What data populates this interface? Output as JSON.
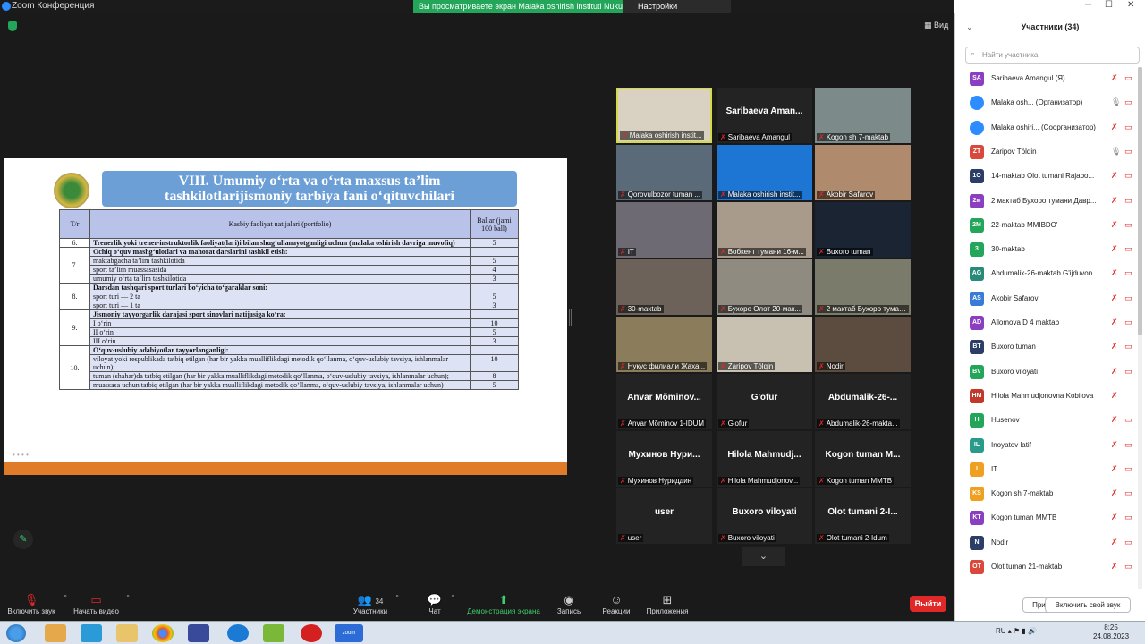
{
  "window": {
    "title": "Zoom Конференция",
    "banner": "Вы просматриваете экран Malaka oshirish instituti Nuku...",
    "view_options": "Настройки просмотра",
    "view_button": "Вид"
  },
  "slide": {
    "title_line1": "VIII. Umumiy o‘rta va o‘rta maxsus ta’lim",
    "title_line2": "tashkilotlarijismoniy tarbiya fani o‘qituvchilari",
    "col_num": "T/r",
    "col_activity": "Kasbiy faoliyat natijalari (portfolio)",
    "col_points": "Ballar (jami 100 ball)",
    "rows": [
      {
        "num": "6.",
        "items": [
          {
            "text": "Trenerlik yoki trener-instruktorlik faoliyat(lari)i bilan shug‘ullanayotganligi uchun (malaka oshirish davriga muvofiq)",
            "pts": "5",
            "bold": true
          }
        ]
      },
      {
        "num": "7.",
        "items": [
          {
            "text": "Ochiq o‘quv mashg‘ulotlari va mahorat darslarini tashkil etish:",
            "pts": "",
            "bold": true
          },
          {
            "text": "maktabgacha ta’lim tashkilotida",
            "pts": "5",
            "bold": false
          },
          {
            "text": "sport ta’lim muassasasida",
            "pts": "4",
            "bold": false
          },
          {
            "text": "umumiy o‘rta ta’lim tashkilotida",
            "pts": "3",
            "bold": false
          }
        ]
      },
      {
        "num": "8.",
        "items": [
          {
            "text": "Darsdan tashqari sport turlari bo‘yicha to‘garaklar soni:",
            "pts": "",
            "bold": true
          },
          {
            "text": "sport turi — 2 ta",
            "pts": "5",
            "bold": false
          },
          {
            "text": "sport turi — 1 ta",
            "pts": "3",
            "bold": false
          }
        ]
      },
      {
        "num": "9.",
        "items": [
          {
            "text": "Jismoniy tayyorgarlik darajasi sport sinovlari natijasiga ko‘ra:",
            "pts": "",
            "bold": true
          },
          {
            "text": "I o‘rin",
            "pts": "10",
            "bold": false
          },
          {
            "text": "II o‘rin",
            "pts": "5",
            "bold": false
          },
          {
            "text": "III o‘rin",
            "pts": "3",
            "bold": false
          }
        ]
      },
      {
        "num": "10.",
        "items": [
          {
            "text": "O‘quv-uslubiy adabiyotlar tayyorlanganligi:",
            "pts": "",
            "bold": true
          },
          {
            "text": "viloyat yoki respublikada tatbiq etilgan (har bir yakka mualliflikdagi metodik qo‘llanma, o‘quv-uslubiy tavsiya, ishlanmalar uchun);",
            "pts": "10",
            "bold": false
          },
          {
            "text": "tuman (shahar)da tatbiq etilgan (har bir yakka mualliflikdagi metodik qo‘llanma, o‘quv-uslubiy tavsiya, ishlanmalar uchun);",
            "pts": "8",
            "bold": false
          },
          {
            "text": "muassasa uchun tatbiq etilgan (har bir yakka mualliflikdagi metodik qo‘llanma, o‘quv-uslubiy tavsiya, ishlanmalar uchun)",
            "pts": "5",
            "bold": false
          }
        ]
      }
    ]
  },
  "tiles": [
    {
      "label": "Malaka oshirish instit...",
      "big": "",
      "bg": "#d9d2c2",
      "active": true
    },
    {
      "label": "Saribaeva Amangul",
      "big": "Saribaeva Aman...",
      "bg": ""
    },
    {
      "label": "Kogon sh 7-maktab",
      "big": "",
      "bg": "#7c8a8a"
    },
    {
      "label": "Qorovulbozor tuman ...",
      "big": "",
      "bg": "#5b6a78"
    },
    {
      "label": "Malaka oshirish instit...",
      "big": "",
      "bg": "#1e76d4"
    },
    {
      "label": "Akobir Safarov",
      "big": "",
      "bg": "#b08a6c"
    },
    {
      "label": "IT",
      "big": "",
      "bg": "#6e6a74"
    },
    {
      "label": "Вобкент тумани 16-м...",
      "big": "",
      "bg": "#a99b8c"
    },
    {
      "label": "Buxoro tuman",
      "big": "",
      "bg": "#1a2433"
    },
    {
      "label": "30-maktab",
      "big": "",
      "bg": "#6c625a"
    },
    {
      "label": "Бухоро Олот 20-мак...",
      "big": "",
      "bg": "#8f8b80"
    },
    {
      "label": "2 мактаб Бухоро туман...",
      "big": "",
      "bg": "#7b7b6c"
    },
    {
      "label": "Нукус филиали Жаха...",
      "big": "",
      "bg": "#8b7c5c"
    },
    {
      "label": "Zaripov Tólqin",
      "big": "",
      "bg": "#c8c0b0"
    },
    {
      "label": "Nodir",
      "big": "",
      "bg": "#5c4c40"
    },
    {
      "label": "Anvar Mõminov 1-IDUM",
      "big": "Anvar Mõminov...",
      "bg": ""
    },
    {
      "label": "G'ofur",
      "big": "G'ofur",
      "bg": ""
    },
    {
      "label": "Abdumalik-26-makta...",
      "big": "Abdumalik-26-...",
      "bg": ""
    },
    {
      "label": "Мухинов Нуриддин",
      "big": "Мухинов Нури...",
      "bg": ""
    },
    {
      "label": "Hilola Mahmudjonov...",
      "big": "Hilola Mahmudj...",
      "bg": ""
    },
    {
      "label": "Kogon tuman MMTB",
      "big": "Kogon tuman M...",
      "bg": ""
    },
    {
      "label": "user",
      "big": "user",
      "bg": ""
    },
    {
      "label": "Buxoro viloyati",
      "big": "Buxoro viloyati",
      "bg": ""
    },
    {
      "label": "Olot tumani 2-Idum",
      "big": "Olot tumani 2-I...",
      "bg": ""
    }
  ],
  "toolbar": {
    "unmute": "Включить звук",
    "video": "Начать видео",
    "participants": "Участники",
    "participants_count": "34",
    "chat": "Чат",
    "share": "Демонстрация экрана",
    "record": "Запись",
    "reactions": "Реакции",
    "apps": "Приложения",
    "leave": "Выйти"
  },
  "panel": {
    "title": "Участники (34)",
    "search_placeholder": "Найти участника",
    "invite": "Пригласить",
    "unmute_me": "Включить свой звук",
    "participants": [
      {
        "initials": "SA",
        "name": "Saribaeva Amangul (Я)",
        "color": "#8a3fc0",
        "mic": "off",
        "cam": "off"
      },
      {
        "initials": "",
        "name": "Malaka osh... (Организатор)",
        "color": "#2d8cff",
        "mic": "on",
        "cam": "on"
      },
      {
        "initials": "",
        "name": "Malaka oshiri... (Соорганизатор)",
        "color": "#2d8cff",
        "mic": "off",
        "cam": "off"
      },
      {
        "initials": "ZT",
        "name": "Zaripov Tólqin",
        "color": "#d9483b",
        "mic": "on",
        "cam": "on"
      },
      {
        "initials": "1O",
        "name": "14-maktab Olot tumani Rajabo...",
        "color": "#2c3e66",
        "mic": "off",
        "cam": "off"
      },
      {
        "initials": "2м",
        "name": "2 мактаб Бухоро тумани Давр...",
        "color": "#8a3fc0",
        "mic": "off",
        "cam": "off"
      },
      {
        "initials": "2M",
        "name": "22-maktab MMIBDO'",
        "color": "#23a55a",
        "mic": "off",
        "cam": "off"
      },
      {
        "initials": "3",
        "name": "30-maktab",
        "color": "#23a55a",
        "mic": "off",
        "cam": "off"
      },
      {
        "initials": "AG",
        "name": "Abdumalik-26-maktab G'ijduvon",
        "color": "#2a8a7a",
        "mic": "off",
        "cam": "off"
      },
      {
        "initials": "AS",
        "name": "Akobir Safarov",
        "color": "#3a7bd5",
        "mic": "off",
        "cam": "off"
      },
      {
        "initials": "AD",
        "name": "Allomova D 4 maktab",
        "color": "#8a3fc0",
        "mic": "off",
        "cam": "off"
      },
      {
        "initials": "BT",
        "name": "Buxoro tuman",
        "color": "#2c3e66",
        "mic": "off",
        "cam": "off"
      },
      {
        "initials": "BV",
        "name": "Buxoro viloyati",
        "color": "#23a55a",
        "mic": "off",
        "cam": "off"
      },
      {
        "initials": "HM",
        "name": "Hilola Mahmudjonovna Kobilova",
        "color": "#c0392b",
        "mic": "off",
        "cam": ""
      },
      {
        "initials": "H",
        "name": "Husenov",
        "color": "#23a55a",
        "mic": "off",
        "cam": "off"
      },
      {
        "initials": "IL",
        "name": "Inoyatov latif",
        "color": "#2a9a8a",
        "mic": "off",
        "cam": "off"
      },
      {
        "initials": "I",
        "name": "IT",
        "color": "#f0a020",
        "mic": "off",
        "cam": "off"
      },
      {
        "initials": "KS",
        "name": "Kogon sh 7-maktab",
        "color": "#f0a020",
        "mic": "off",
        "cam": "off"
      },
      {
        "initials": "KT",
        "name": "Kogon tuman MMTB",
        "color": "#8a3fc0",
        "mic": "off",
        "cam": "off"
      },
      {
        "initials": "N",
        "name": "Nodir",
        "color": "#2c3e66",
        "mic": "off",
        "cam": "off"
      },
      {
        "initials": "OT",
        "name": "Olot tuman 21-maktab",
        "color": "#d9483b",
        "mic": "off",
        "cam": "off"
      }
    ]
  },
  "taskbar": {
    "lang": "RU",
    "time": "8:25",
    "date": "24.08.2023",
    "zoom_label": "zoom"
  }
}
